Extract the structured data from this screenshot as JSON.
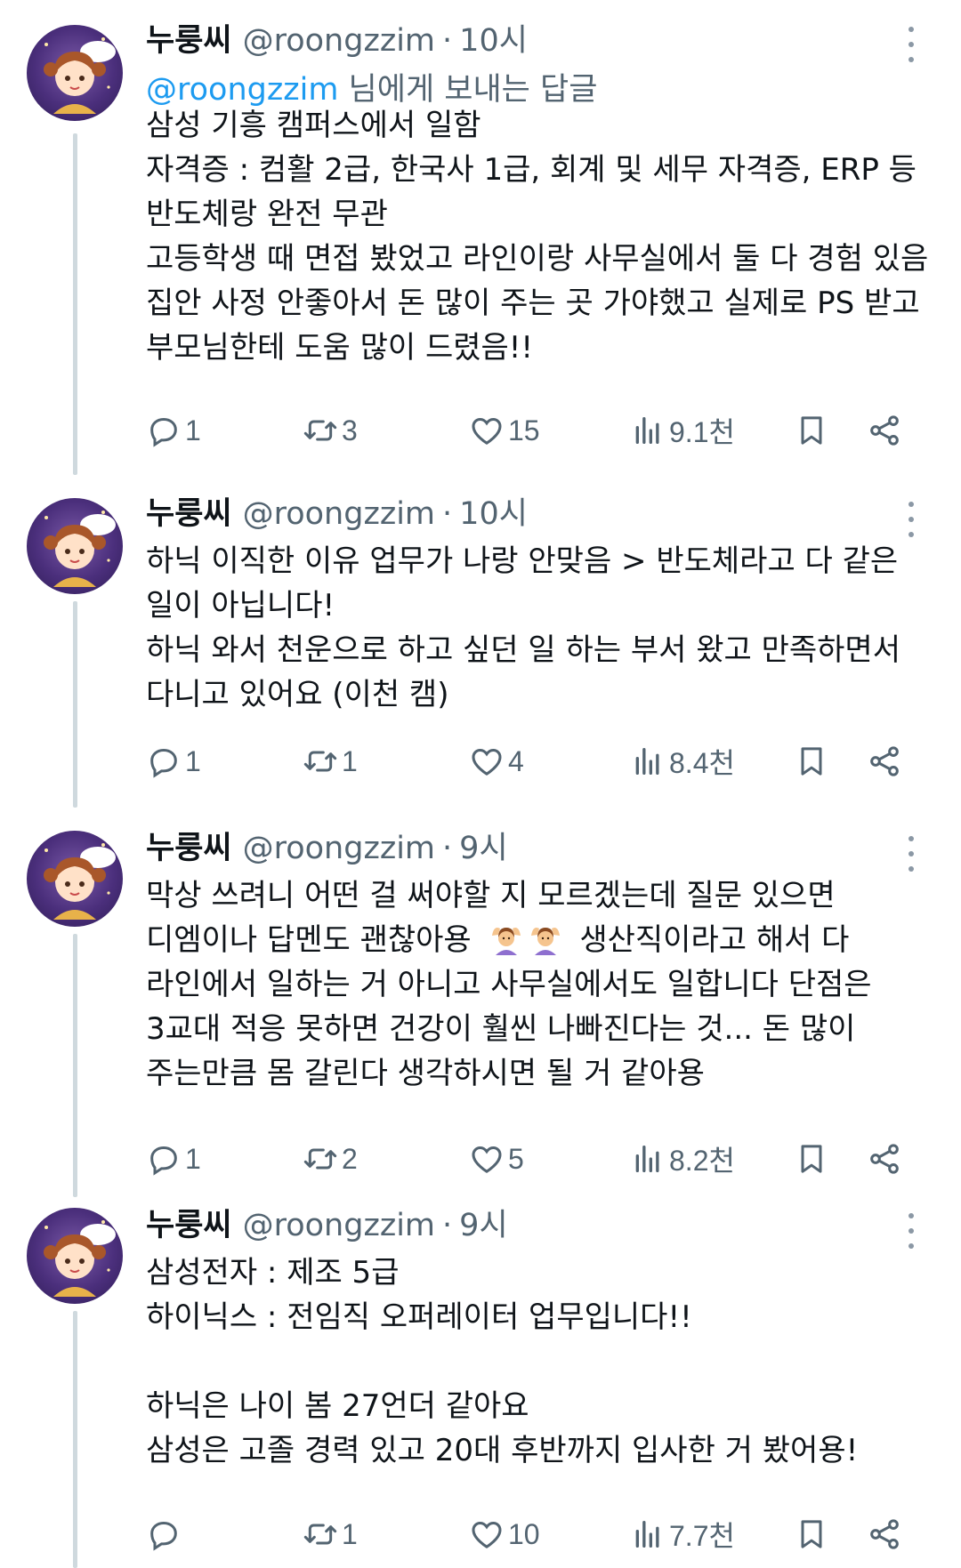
{
  "colors": {
    "accent": "#1d9bf0",
    "text": "#0f1419",
    "muted": "#536471",
    "thread_line": "#cfd9de"
  },
  "tweets": [
    {
      "name": "누룽씨",
      "handle": "@roongzzim",
      "time": "10시",
      "reply_mention": "@roongzzim",
      "reply_suffix": " 님에게 보내는 답글",
      "lines": [
        "삼성 기흥 캠퍼스에서 일함",
        "자격증 : 컴활 2급, 한국사 1급, 회계 및 세무 자격증, ERP 등",
        "반도체랑 완전 무관",
        "고등학생 때 면접 봤었고 라인이랑 사무실에서 둘 다 경험 있음",
        "집안 사정 안좋아서 돈 많이 주는 곳 가야했고 실제로 PS 받고",
        "부모님한테 도움 많이 드렸음!!"
      ],
      "stats": {
        "replies": "1",
        "retweets": "3",
        "likes": "15",
        "views": "9.1천"
      }
    },
    {
      "name": "누룽씨",
      "handle": "@roongzzim",
      "time": "10시",
      "lines": [
        "하닉 이직한 이유 업무가 나랑 안맞음 > 반도체라고 다 같은",
        "일이 아닙니다!",
        "하닉 와서 천운으로 하고 싶던 일 하는 부서 왔고 만족하면서",
        "다니고 있어요 (이천 캠)"
      ],
      "stats": {
        "replies": "1",
        "retweets": "1",
        "likes": "4",
        "views": "8.4천"
      }
    },
    {
      "name": "누룽씨",
      "handle": "@roongzzim",
      "time": "9시",
      "lines": [
        "막상 쓰려니 어떤 걸 써야할 지 모르겠는데 질문 있으면",
        "디엠이나 답멘도 괜찮아용",
        "생산직이라고 해서 다",
        "라인에서 일하는 거 아니고 사무실에서도 일합니다 단점은",
        "3교대 적응 못하면 건강이 훨씬 나빠진다는 것... 돈 많이",
        "주는만큼 몸 갈린다 생각하시면 될 거 같아용"
      ],
      "emoji": [
        "person-gesturing-ok",
        "person-gesturing-ok"
      ],
      "stats": {
        "replies": "1",
        "retweets": "2",
        "likes": "5",
        "views": "8.2천"
      }
    },
    {
      "name": "누룽씨",
      "handle": "@roongzzim",
      "time": "9시",
      "lines": [
        "삼성전자 : 제조 5급",
        "하이닉스 : 전임직 오퍼레이터 업무입니다!!",
        "",
        "하닉은 나이 봄 27언더 같아요",
        "삼성은 고졸 경력 있고 20대 후반까지 입사한 거 봤어용!"
      ],
      "stats": {
        "replies": "",
        "retweets": "1",
        "likes": "10",
        "views": "7.7천"
      }
    }
  ],
  "icons": {
    "reply": "reply-icon",
    "retweet": "retweet-icon",
    "like": "heart-icon",
    "views": "views-chart-icon",
    "bookmark": "bookmark-icon",
    "share": "share-icon",
    "more": "more-dots-icon"
  }
}
